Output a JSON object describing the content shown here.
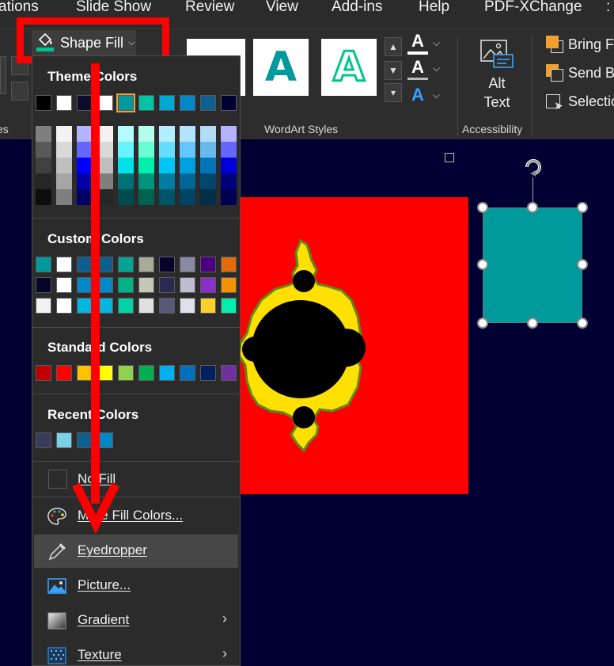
{
  "ribbon": {
    "tabs": [
      "ations",
      "Slide Show",
      "Review",
      "View",
      "Add-ins",
      "Help",
      "PDF-XChange",
      ":"
    ],
    "group_labels": {
      "left_cut": "es",
      "wordart": "WordArt Styles",
      "accessibility": "Accessibility"
    },
    "wordart_letter": "A",
    "text_letter": "A",
    "alt_text": {
      "line1": "Alt",
      "line2": "Text"
    },
    "arrange": {
      "bring_forward": "Bring Fo",
      "send_backward": "Send Ba",
      "selection": "Selection"
    }
  },
  "shape_fill": {
    "label": "Shape Fill",
    "icon": "paint-bucket-icon",
    "underline_color": "#00c58f"
  },
  "menu": {
    "theme_colors_title": "Theme Colors",
    "theme_colors": [
      "#000000",
      "#ffffff",
      "#0d0d2b",
      "#ffffff",
      "#00999c",
      "#00c5a4",
      "#00a8d4",
      "#0088c7",
      "#0c5f8f",
      "#000033"
    ],
    "theme_shades": [
      [
        "#7f7f7f",
        "#595959",
        "#404040",
        "#262626",
        "#0d0d0d"
      ],
      [
        "#f2f2f2",
        "#d9d9d9",
        "#bfbfbf",
        "#a6a6a6",
        "#7f7f7f"
      ],
      [
        "#b3b3ff",
        "#6666ff",
        "#0000ff",
        "#0000a6",
        "#000066"
      ],
      [
        "#f2f2f2",
        "#d9d9d9",
        "#bfbfbf",
        "#7f7f7f",
        "#262626"
      ],
      [
        "#b3fcff",
        "#66f5ff",
        "#00e2ea",
        "#007275",
        "#004b4d"
      ],
      [
        "#b3ffe9",
        "#66ffd3",
        "#00f0ac",
        "#00947a",
        "#00624f"
      ],
      [
        "#b3eeff",
        "#66ddff",
        "#00c5f6",
        "#007e9f",
        "#00546a"
      ],
      [
        "#b3e3ff",
        "#66c6ff",
        "#00a0e0",
        "#006696",
        "#004464"
      ],
      [
        "#b3dcf5",
        "#66b9eb",
        "#0076b8",
        "#00476b",
        "#002f47"
      ],
      [
        "#b3b3ff",
        "#6666ff",
        "#0000d9",
        "#00007a",
        "#000052"
      ]
    ],
    "custom_colors_title": "Custom Colors",
    "custom_colors": [
      [
        "#00999c",
        "#ffffff",
        "#0c5f8f",
        "#0c5f8f",
        "#00a693",
        "#a8ab98",
        "#05052b",
        "#8a8aa4",
        "#4b0082",
        "#e26b0a",
        "#e30b3c"
      ],
      [
        "#05052b",
        "#ffffff",
        "#0088c7",
        "#0088c7",
        "#00b386",
        "#c6c7b8",
        "#2a2a50",
        "#bebed0",
        "#8b2fc9",
        "#f39200",
        "#f08080"
      ],
      [
        "#f2f2f2",
        "#ffffff",
        "#00b7e0",
        "#00b7e0",
        "#00d4a6",
        "#e0e0dc",
        "#5a5a78",
        "#e0e0ea",
        "#ffd02a",
        "#00f0ac",
        "#00ddd4"
      ]
    ],
    "standard_colors_title": "Standard Colors",
    "standard_colors": [
      "#c00000",
      "#ff0000",
      "#ffc000",
      "#ffff00",
      "#92d050",
      "#00b050",
      "#00b0f0",
      "#0070c0",
      "#002060",
      "#7030a0"
    ],
    "recent_colors_title": "Recent Colors",
    "recent_colors": [
      "#3a3a5c",
      "#7ad2ea",
      "#0c5f8f",
      "#0088c7"
    ],
    "items": {
      "no_fill": "No Fill",
      "more_colors": "More Fill Colors...",
      "eyedropper": "Eyedropper",
      "picture": "Picture...",
      "gradient": "Gradient",
      "texture": "Texture"
    }
  },
  "slide": {
    "teal_shape_color": "#00999c",
    "mandelbrot_bg": "#ff0000",
    "slide_bg": "#000033"
  },
  "annotation": {
    "color": "#ff0000"
  }
}
